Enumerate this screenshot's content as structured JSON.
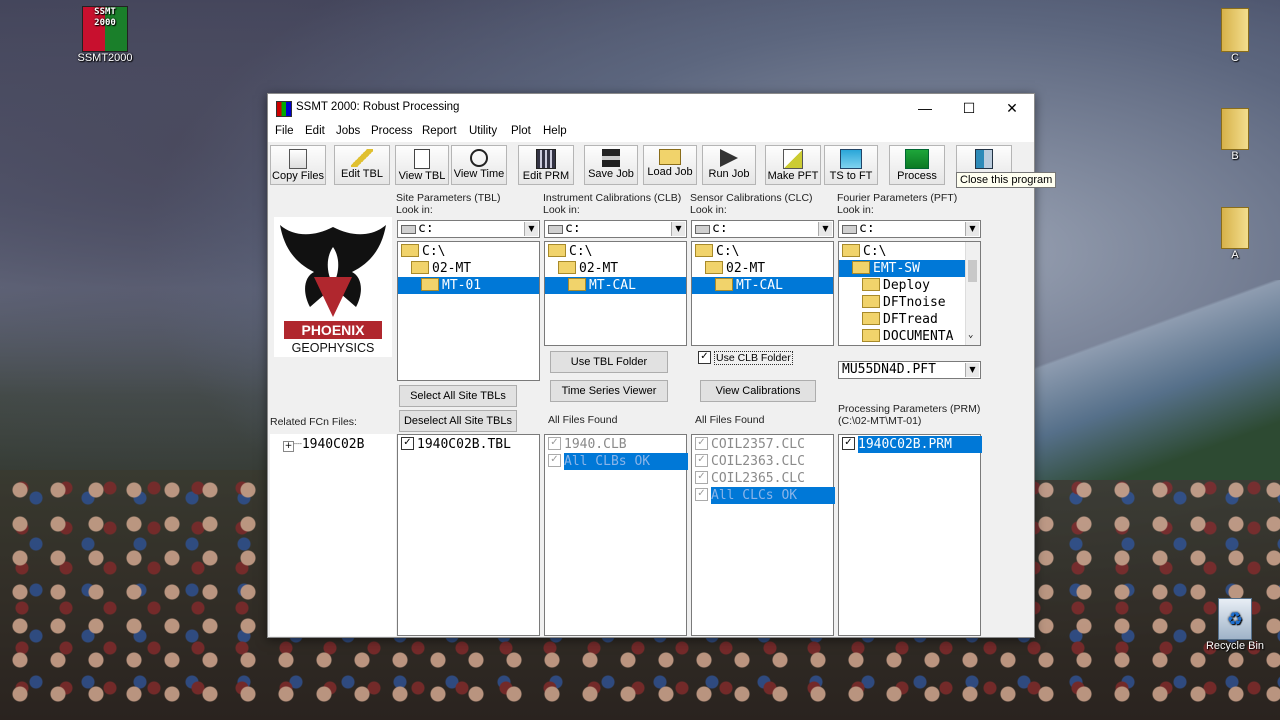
{
  "desktop": {
    "icons": [
      {
        "label": "SSMT2000"
      },
      {
        "label": "C"
      },
      {
        "label": "B"
      },
      {
        "label": "A"
      },
      {
        "label": "Recycle Bin"
      }
    ],
    "ssmt_icon_text": "SSMT 2000"
  },
  "window": {
    "title": "SSMT 2000: Robust Processing",
    "controls": {
      "minimize": "—",
      "maximize": "☐",
      "close": "✕"
    },
    "menu": [
      "File",
      "Edit",
      "Jobs",
      "Process",
      "Report",
      "Utility",
      "Plot",
      "Help"
    ],
    "toolbar": [
      {
        "label": "Copy Files",
        "icon": "copy-files-icon"
      },
      {
        "label": "Edit TBL",
        "icon": "pencil-icon"
      },
      {
        "label": "View TBL",
        "icon": "view-document-icon"
      },
      {
        "label": "View Time",
        "icon": "stopwatch-icon"
      },
      {
        "label": "Edit PRM",
        "icon": "calculator-icon"
      },
      {
        "label": "Save Job",
        "icon": "floppy-disk-icon"
      },
      {
        "label": "Load Job",
        "icon": "open-folder-icon"
      },
      {
        "label": "Run Job",
        "icon": "run-arrow-icon"
      },
      {
        "label": "Make PFT",
        "icon": "make-pft-icon"
      },
      {
        "label": "TS to FT",
        "icon": "ts-to-ft-icon"
      },
      {
        "label": "Process",
        "icon": "process-wave-icon"
      },
      {
        "label": "",
        "icon": "exit-door-icon"
      }
    ],
    "tooltip": "Close this program",
    "logo": {
      "brand": "PHOENIX",
      "sub": "GEOPHYSICS"
    },
    "panels": {
      "site": {
        "title": "Site Parameters (TBL)",
        "look_in": "Look in:",
        "drive": "c:",
        "dirs": [
          "C:\\",
          "02-MT",
          "MT-01"
        ]
      },
      "instrument": {
        "title": "Instrument Calibrations (CLB)",
        "look_in": "Look in:",
        "drive": "c:",
        "dirs": [
          "C:\\",
          "02-MT",
          "MT-CAL"
        ]
      },
      "sensor": {
        "title": "Sensor Calibrations (CLC)",
        "look_in": "Look in:",
        "drive": "c:",
        "dirs": [
          "C:\\",
          "02-MT",
          "MT-CAL"
        ]
      },
      "fourier": {
        "title": "Fourier Parameters (PFT)",
        "look_in": "Look in:",
        "drive": "c:",
        "dirs": [
          "C:\\",
          "EMT-SW",
          "Deploy",
          "DFTnoise",
          "DFTread",
          "DOCUMENTA"
        ],
        "pft_file": "MU55DN4D.PFT"
      }
    },
    "buttons": {
      "use_tbl_folder": "Use TBL Folder",
      "time_series_viewer": "Time Series Viewer",
      "use_clb_folder": "Use CLB Folder",
      "view_calibrations": "View Calibrations",
      "select_all": "Select All Site TBLs",
      "deselect_all": "Deselect All Site TBLs"
    },
    "labels": {
      "related_fcn": "Related FCn Files:",
      "all_files_found_1": "All Files Found",
      "all_files_found_2": "All Files Found",
      "processing_params": "Processing Parameters (PRM)",
      "processing_path": "(C:\\02-MT\\MT-01)"
    },
    "lists": {
      "fcn_tree": [
        "1940C02B"
      ],
      "tbl_files": [
        "1940C02B.TBL"
      ],
      "clb_files": [
        "1940.CLB",
        "All CLBs OK"
      ],
      "clc_files": [
        "COIL2357.CLC",
        "COIL2363.CLC",
        "COIL2365.CLC",
        "All CLCs OK"
      ],
      "prm_files": [
        "1940C02B.PRM"
      ]
    }
  }
}
